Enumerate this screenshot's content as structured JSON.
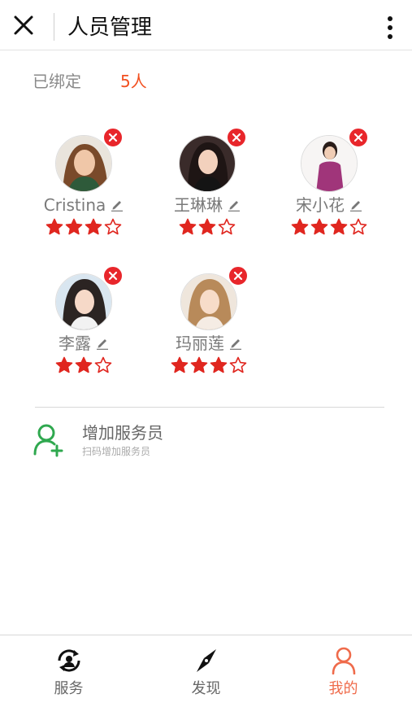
{
  "header": {
    "title": "人员管理",
    "close_icon": "close-icon",
    "more_icon": "more-vertical-icon"
  },
  "summary": {
    "label": "已绑定",
    "count": "5人"
  },
  "staff": [
    {
      "name": "Cristina",
      "rating": 3,
      "max_rating": 4
    },
    {
      "name": "王琳琳",
      "rating": 2,
      "max_rating": 3
    },
    {
      "name": "宋小花",
      "rating": 3,
      "max_rating": 4
    },
    {
      "name": "李露",
      "rating": 2,
      "max_rating": 3
    },
    {
      "name": "玛丽莲",
      "rating": 3,
      "max_rating": 4
    }
  ],
  "add_staff": {
    "title": "增加服务员",
    "subtitle": "扫码增加服务员",
    "icon": "add-user-icon"
  },
  "tabs": [
    {
      "label": "服务",
      "icon": "service-refresh-icon",
      "active": false
    },
    {
      "label": "发现",
      "icon": "compass-icon",
      "active": false
    },
    {
      "label": "我的",
      "icon": "user-icon",
      "active": true
    }
  ],
  "colors": {
    "accent": "#f24f1f",
    "star": "#e0261f",
    "remove_badge": "#e8262b",
    "add_icon": "#2fa84f",
    "active_tab": "#ef6b4b"
  }
}
